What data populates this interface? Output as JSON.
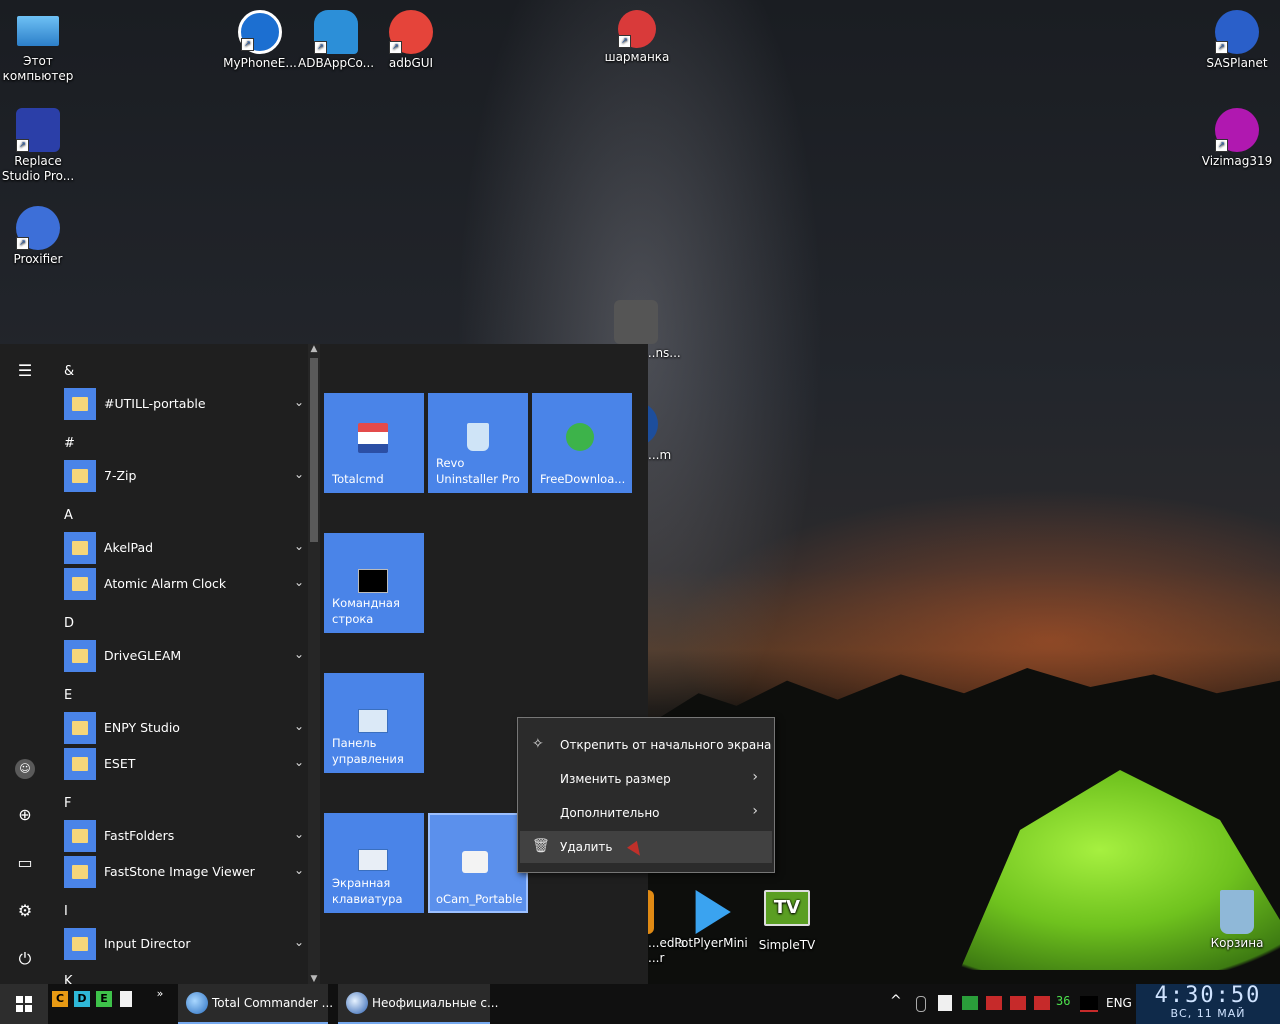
{
  "desktop": {
    "icons": [
      {
        "label_line1": "Этот",
        "label_line2": "компьютер",
        "color": "#5aa9e6"
      },
      {
        "label_line1": "Replace",
        "label_line2": "Studio Pro...",
        "color": "#2b3fa8"
      },
      {
        "label_line1": "Proxifier",
        "color": "#3d6fd8"
      },
      {
        "label_line1": "MyPhoneE...",
        "color": "#1c6fd1"
      },
      {
        "label_line1": "ADBAppCo...",
        "color": "#2c8fd8"
      },
      {
        "label_line1": "adbGUI",
        "color": "#e5443a"
      },
      {
        "label_line1": "шарманка",
        "color": "#d93a3a"
      },
      {
        "label_line1": "SASPlanet",
        "color": "#2a5fc9"
      },
      {
        "label_line1": "Vizimag319",
        "color": "#b018b0"
      },
      {
        "label_line1": "...ns...",
        "color": "#555555"
      },
      {
        "label_line1": "...m",
        "color": "#1d4e9c"
      },
      {
        "label_line1": "...edia",
        "label_line2": "...r",
        "color": "#e08a14"
      },
      {
        "label_line1": "PotPlyerMini",
        "color": "#3aa3f0"
      },
      {
        "label_line1": "SimpleTV",
        "color": "#5a9e22"
      },
      {
        "label_line1": "Корзина",
        "color": "#8fb8d8"
      }
    ]
  },
  "start_menu": {
    "rail_icons": [
      "hamburger-icon",
      "user-icon",
      "globe-icon",
      "pictures-icon",
      "settings-icon",
      "power-icon"
    ],
    "groups": [
      {
        "letter": "&",
        "apps": [
          "#UTILL-portable"
        ]
      },
      {
        "letter": "#",
        "apps": [
          "7-Zip"
        ]
      },
      {
        "letter": "A",
        "apps": [
          "AkelPad",
          "Atomic Alarm Clock"
        ]
      },
      {
        "letter": "D",
        "apps": [
          "DriveGLEAM"
        ]
      },
      {
        "letter": "E",
        "apps": [
          "ENPY Studio",
          "ESET"
        ]
      },
      {
        "letter": "F",
        "apps": [
          "FastFolders",
          "FastStone Image Viewer"
        ]
      },
      {
        "letter": "I",
        "apps": [
          "Input Director"
        ]
      },
      {
        "letter": "K",
        "apps": []
      }
    ],
    "tiles": [
      {
        "label_line1": "Totalcmd"
      },
      {
        "label_line1": "Revo",
        "label_line2": "Uninstaller Pro"
      },
      {
        "label_line1": "FreeDownloa..."
      },
      {
        "label_line1": "Командная",
        "label_line2": "строка"
      },
      {
        "label_line1": "Панель",
        "label_line2": "управления"
      },
      {
        "label_line1": "Экранная",
        "label_line2": "клавиатура"
      },
      {
        "label_line1": "oCam_Portable"
      }
    ]
  },
  "context_menu": {
    "items": [
      {
        "label": "Открепить от начального экрана",
        "icon": "unpin-icon"
      },
      {
        "label": "Изменить размер",
        "icon": "",
        "submenu": "›"
      },
      {
        "label": "Дополнительно",
        "icon": "",
        "submenu": "›"
      },
      {
        "label": "Удалить",
        "icon": "trash-icon"
      }
    ]
  },
  "taskbar": {
    "quick_launch": [
      "C",
      "D",
      "E"
    ],
    "more": "»",
    "tasks": [
      {
        "label": "Total Commander ..."
      },
      {
        "label": "Неофициальные с..."
      }
    ],
    "tray": {
      "chevron": "^",
      "counter": "36",
      "language": "ENG"
    },
    "clock": {
      "time": "4:30:50",
      "date": "ВС, 11 МАЙ"
    }
  }
}
